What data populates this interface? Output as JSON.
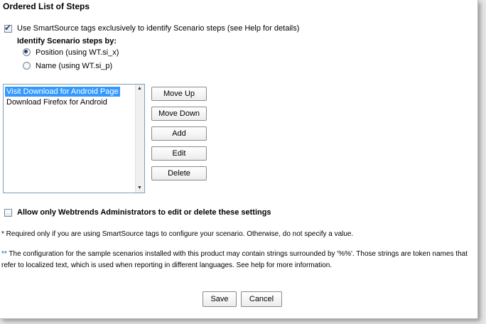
{
  "section_title": "Ordered List of Steps",
  "use_smartsource": {
    "checked": true,
    "label": "Use SmartSource tags exclusively to identify Scenario steps (see Help for details)"
  },
  "identify_by": {
    "heading": "Identify Scenario steps by:",
    "options": [
      {
        "label": "Position (using WT.si_x)",
        "selected": true
      },
      {
        "label": "Name (using WT.si_p)",
        "selected": false
      }
    ]
  },
  "steps_list": {
    "items": [
      {
        "label": "Visit Download for Android Page",
        "selected": true
      },
      {
        "label": "Download Firefox for Android",
        "selected": false
      }
    ]
  },
  "list_buttons": {
    "move_up": "Move Up",
    "move_down": "Move Down",
    "add": "Add",
    "edit": "Edit",
    "delete": "Delete"
  },
  "admin_only": {
    "checked": false,
    "label": "Allow only Webtrends Administrators to edit or delete these settings"
  },
  "notes": {
    "required_marker": "*",
    "required_text": " Required only if you are using SmartSource tags to configure your scenario. Otherwise, do not specify a value.",
    "token_marker": "**",
    "token_text": " The configuration for the sample scenarios installed with this product may contain strings surrounded by '%%'. Those strings are token names that refer to localized text, which is used when reporting in different languages. See help for more information."
  },
  "footer": {
    "save": "Save",
    "cancel": "Cancel"
  },
  "colors": {
    "selection": "#3399ff",
    "token_marker": "#1f4fd1"
  }
}
